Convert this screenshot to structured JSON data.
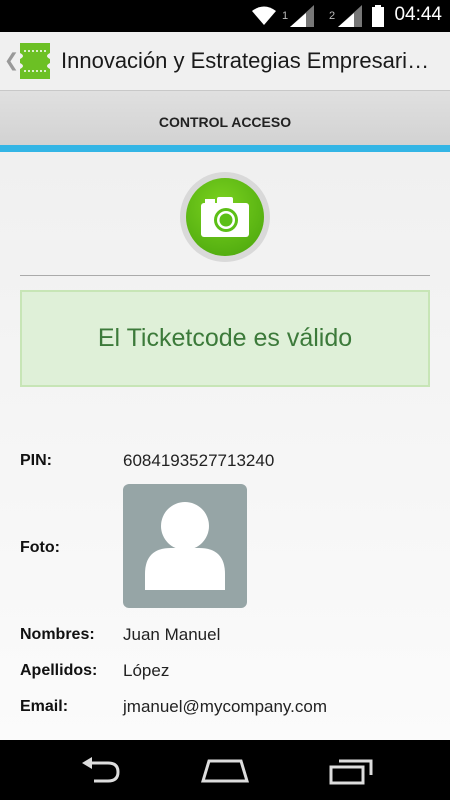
{
  "status_bar": {
    "time": "04:44",
    "sim1_label": "1",
    "sim2_label": "2",
    "icons": [
      "wifi-icon",
      "signal-icon",
      "signal-icon",
      "battery-icon"
    ]
  },
  "action_bar": {
    "title": "Innovación y Estrategias Empresariales"
  },
  "tabs": [
    {
      "label": "CONTROL ACCESO",
      "selected": true
    }
  ],
  "scan": {
    "icon": "camera-icon"
  },
  "result": {
    "message": "El Ticketcode es válido",
    "color": "#3c7a3a",
    "background": "#dff0d8"
  },
  "ticket": {
    "pin_label": "PIN:",
    "pin_value": "6084193527713240",
    "photo_label": "Foto:",
    "first_name_label": "Nombres:",
    "first_name_value": "Juan Manuel",
    "last_name_label": "Apellidos:",
    "last_name_value": "López",
    "email_label": "Email:",
    "email_value": "jmanuel@mycompany.com"
  },
  "colors": {
    "accent": "#33b5e5",
    "camera_green": "#5cbf16"
  },
  "nav_bar": {
    "icons": [
      "back-icon",
      "home-icon",
      "recent-apps-icon"
    ]
  }
}
